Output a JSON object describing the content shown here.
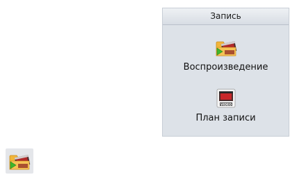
{
  "panel": {
    "title": "Запись",
    "items": [
      {
        "label": "Воспроизведение",
        "icon": "playback-folder-icon"
      },
      {
        "label": "План записи",
        "icon": "video-schedule-icon"
      }
    ]
  },
  "floating_button": {
    "icon": "playback-folder-icon"
  },
  "colors": {
    "panel_bg": "#dde2e8",
    "header_bg": "#e6eaef",
    "folder": "#f2b53a",
    "arrow": "#3fb52c",
    "film": "#4a2b2b",
    "film_red": "#c8282a"
  }
}
